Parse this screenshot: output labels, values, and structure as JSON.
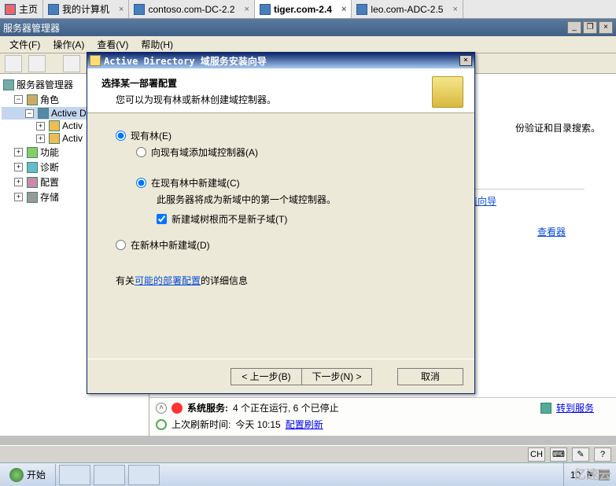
{
  "tabs": [
    {
      "label": "主页"
    },
    {
      "label": "我的计算机"
    },
    {
      "label": "contoso.com-DC-2.2"
    },
    {
      "label": "tiger.com-2.4",
      "active": true
    },
    {
      "label": "leo.com-ADC-2.5"
    }
  ],
  "server_manager": {
    "title": "服务器管理器",
    "menus": {
      "file": "文件(F)",
      "ops": "操作(A)",
      "view": "查看(V)",
      "help": "帮助(H)"
    }
  },
  "tree": {
    "root": "服务器管理器",
    "roles": "角色",
    "ad": "Active D",
    "activ": "Activ",
    "activ2": "Activ",
    "func": "功能",
    "diag": "诊断",
    "config": "配置",
    "storage": "存储"
  },
  "right_pane": {
    "auth_text": "份验证和目录搜索。",
    "link1": "安装向导",
    "link2": "查看器"
  },
  "status": {
    "svc_label": "系统服务:",
    "svc_text": "4 个正在运行, 6 个已停止",
    "goto": "转到服务",
    "refresh_label": "上次刷新时间:",
    "refresh_time": "今天 10:15",
    "refresh_link": "配置刷新"
  },
  "langbar": {
    "ch": "CH"
  },
  "taskbar": {
    "start": "开始",
    "time": "10",
    "flag": "⚑"
  },
  "watermark": "亿速云",
  "wizard": {
    "title": "Active Directory 域服务安装向导",
    "head_title": "选择某一部署配置",
    "head_sub": "您可以为现有林或新林创建域控制器。",
    "opt_existing": "现有林(E)",
    "opt_add_dc": "向现有域添加域控制器(A)",
    "opt_new_domain": "在现有林中新建域(C)",
    "new_domain_desc": "此服务器将成为新域中的第一个域控制器。",
    "chk_root": "新建域树根而不是新子域(T)",
    "opt_new_forest": "在新林中新建域(D)",
    "link_pre": "有关",
    "link_text": "可能的部署配置",
    "link_post": "的详细信息",
    "btn_back": "< 上一步(B)",
    "btn_next": "下一步(N) >",
    "btn_cancel": "取消"
  }
}
